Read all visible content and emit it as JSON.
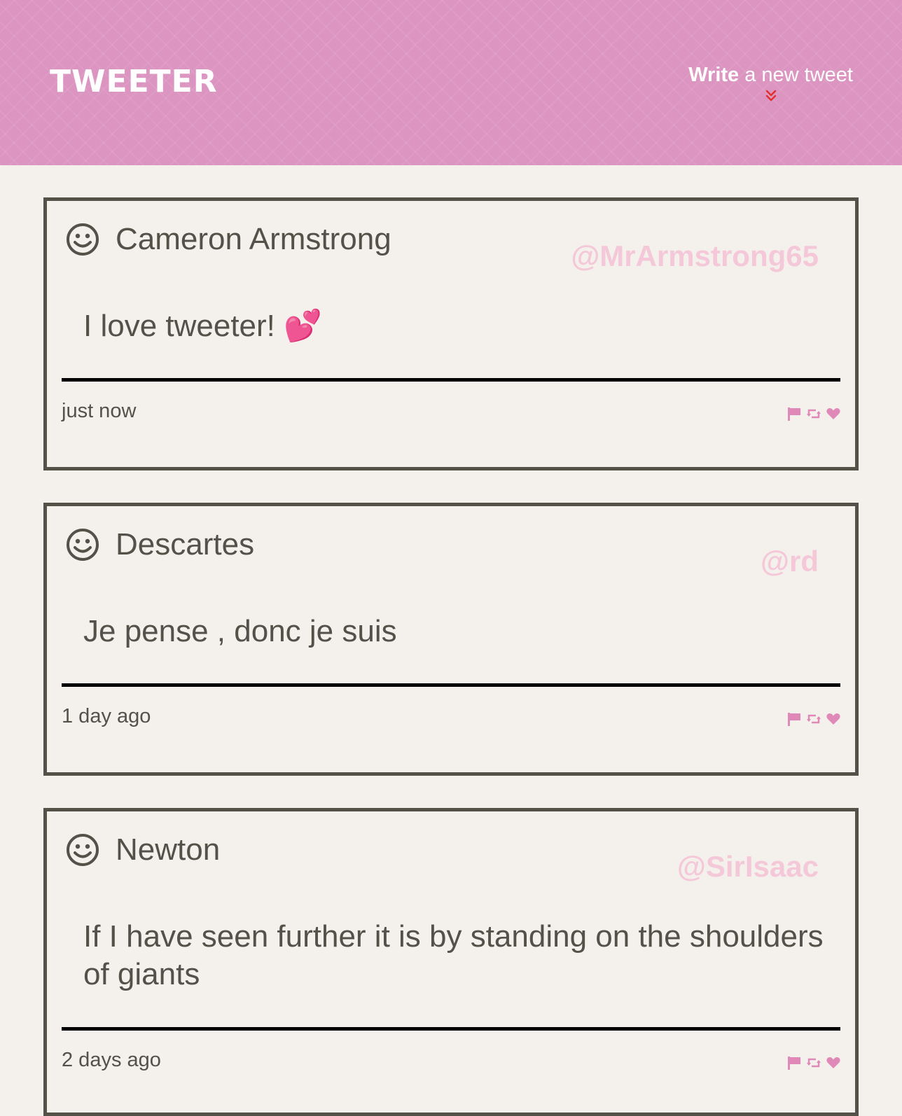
{
  "header": {
    "logo": "TWEETER",
    "compose_strong": "Write",
    "compose_rest": " a new tweet",
    "chevron_icon": "chevron-double-down",
    "background_color": "#dc94c1",
    "chevron_color": "#e0312f"
  },
  "colors": {
    "page_background": "#f4f1ec",
    "text": "#545149",
    "handle": "#f4c8d9",
    "action_icons": "#e089b8",
    "divider": "#000000"
  },
  "tweets": [
    {
      "name": "Cameron Armstrong",
      "handle": "@MrArmstrong65",
      "text": "I love tweeter! 💕",
      "time": "just now",
      "avatar_icon": "smiley-face",
      "actions": [
        "flag",
        "retweet",
        "heart"
      ]
    },
    {
      "name": "Descartes",
      "handle": "@rd",
      "text": "Je pense , donc je suis",
      "time": "1 day ago",
      "avatar_icon": "smiley-face",
      "actions": [
        "flag",
        "retweet",
        "heart"
      ]
    },
    {
      "name": "Newton",
      "handle": "@SirIsaac",
      "text": "If I have seen further it is by standing on the shoulders of giants",
      "time": "2 days ago",
      "avatar_icon": "smiley-face",
      "actions": [
        "flag",
        "retweet",
        "heart"
      ]
    }
  ]
}
